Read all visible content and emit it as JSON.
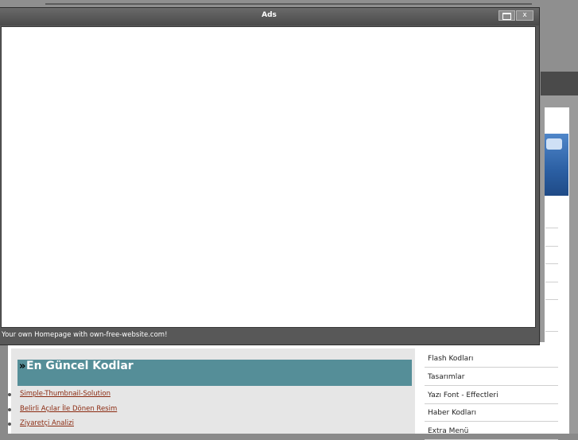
{
  "popup": {
    "title": "Ads",
    "footer_text": "Your own Homepage with own-free-website.com!",
    "close_label": "x"
  },
  "latest_codes": {
    "marker": "»",
    "title": "En Güncel Kodlar",
    "links": [
      "Simple-Thumbnail-Solution",
      "Belirli Açılar İle Dönen Resim",
      "Ziyaretçi Analizi"
    ]
  },
  "side_menu": {
    "items": [
      "Flash Kodları",
      "Tasarımlar",
      "Yazı Font - Effectleri",
      "Haber Kodları",
      "Extra Menü"
    ]
  },
  "colors": {
    "header_bg": "#558e98",
    "link": "#8b2a10",
    "popup_bg": "#585858"
  }
}
